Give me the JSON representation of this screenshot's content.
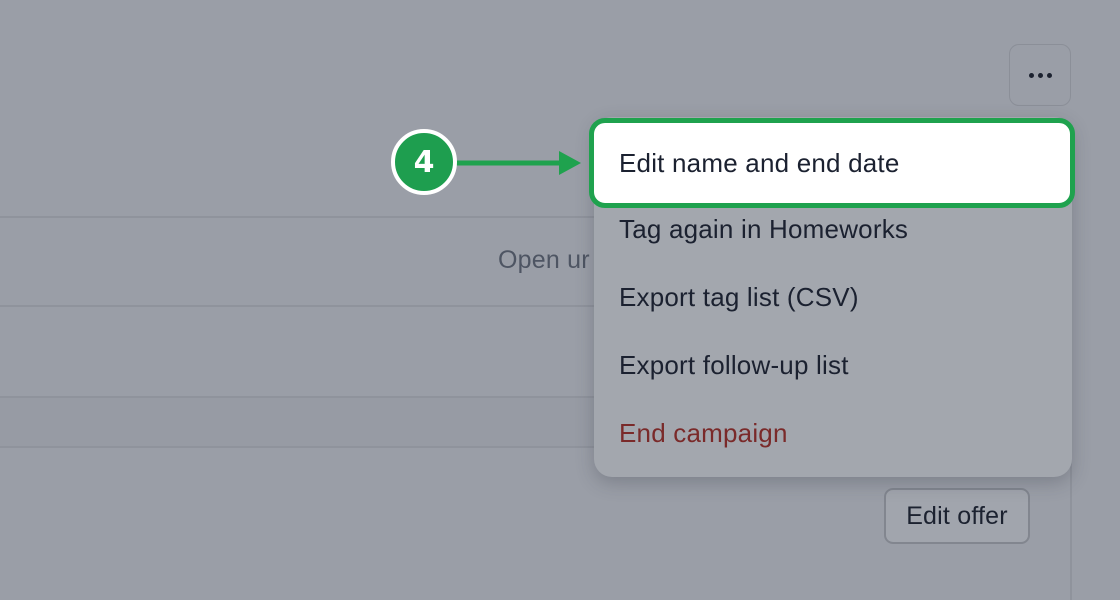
{
  "background": {
    "partial_text": "Open ur"
  },
  "toolbar": {
    "more_icon": "more-horizontal-icon"
  },
  "menu": {
    "items": [
      {
        "label": "Edit name and end date"
      },
      {
        "label": "Tag again in Homeworks"
      },
      {
        "label": "Export tag list (CSV)"
      },
      {
        "label": "Export follow-up list"
      },
      {
        "label": "End campaign"
      }
    ]
  },
  "page": {
    "edit_offer_label": "Edit offer"
  },
  "annotation": {
    "step_number": "4",
    "color": "#1fa24e"
  }
}
